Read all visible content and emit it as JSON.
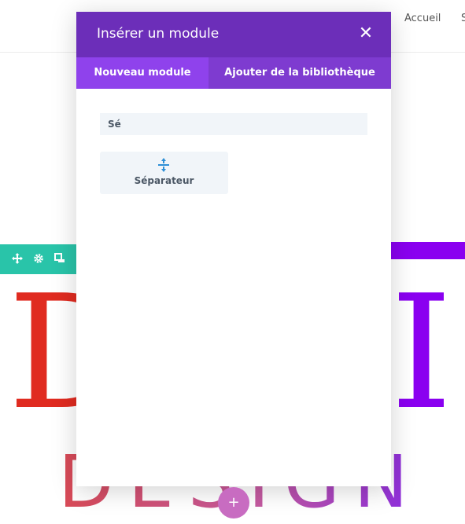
{
  "header": {
    "nav_items": [
      "Accueil",
      "S"
    ]
  },
  "background": {
    "big_letters": [
      "D",
      "I"
    ],
    "design_word": "DESIGN",
    "add_button_label": "+"
  },
  "modal": {
    "title": "Insérer un module",
    "close_label": "✕",
    "tabs": [
      {
        "label": "Nouveau module",
        "active": true
      },
      {
        "label": "Ajouter de la bibliothèque",
        "active": false
      }
    ],
    "search": {
      "value": "Sé"
    },
    "modules": [
      {
        "label": "Séparateur",
        "icon": "divider-icon"
      }
    ]
  },
  "colors": {
    "modal_header": "#6c2eb9",
    "tabs_bg": "#7e3bd0",
    "tab_active": "#8f42ec",
    "row_toolbar": "#29c4a9",
    "accent_red": "#e02b20",
    "accent_purple": "#8a00f0"
  }
}
